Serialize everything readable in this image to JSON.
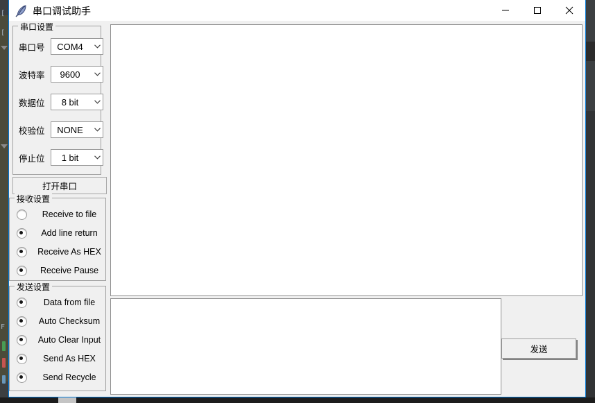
{
  "window": {
    "title": "串口调试助手",
    "icon": "feather-quill-icon",
    "border_color": "#0078d7",
    "controls": {
      "minimize": "minimize-icon",
      "maximize": "maximize-icon",
      "close": "close-icon"
    }
  },
  "serial_settings": {
    "group_title": "串口设置",
    "fields": [
      {
        "label": "串口号",
        "value": "COM4"
      },
      {
        "label": "波特率",
        "value": "9600"
      },
      {
        "label": "数据位",
        "value": "8 bit"
      },
      {
        "label": "校验位",
        "value": "NONE"
      },
      {
        "label": "停止位",
        "value": "1 bit"
      }
    ],
    "open_button": "打开串口"
  },
  "receive_settings": {
    "group_title": "接收设置",
    "options": [
      {
        "label": "Receive to file",
        "selected": false
      },
      {
        "label": "Add line return",
        "selected": true
      },
      {
        "label": "Receive As HEX",
        "selected": true
      },
      {
        "label": "Receive Pause",
        "selected": true
      }
    ]
  },
  "send_settings": {
    "group_title": "发送设置",
    "options": [
      {
        "label": "Data from file",
        "selected": true
      },
      {
        "label": "Auto Checksum",
        "selected": true
      },
      {
        "label": "Auto Clear Input",
        "selected": true
      },
      {
        "label": "Send As HEX",
        "selected": true
      },
      {
        "label": "Send Recycle",
        "selected": true
      }
    ]
  },
  "receive_area": {
    "value": "",
    "placeholder": ""
  },
  "send_area": {
    "value": "",
    "placeholder": ""
  },
  "send_button": {
    "label": "发送"
  }
}
